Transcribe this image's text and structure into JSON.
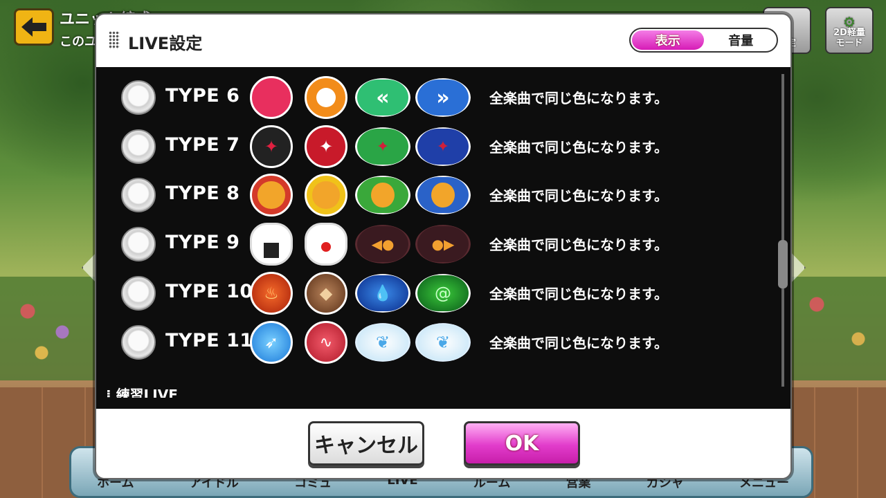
{
  "screen": {
    "title": "ユニット編成",
    "subtitle": "このユ",
    "top_right": [
      {
        "label": "設定",
        "icon": "settings-icon"
      },
      {
        "label_line1": "2D軽量",
        "label_line2": "モード",
        "icon": "gear-icon"
      }
    ],
    "bottom_nav": [
      "ホーム",
      "アイドル",
      "コミュ",
      "LIVE",
      "ルーム",
      "営業",
      "ガシャ",
      "メニュー"
    ]
  },
  "dialog": {
    "title": "LIVE設定",
    "tabs": [
      {
        "label": "表示",
        "active": true
      },
      {
        "label": "音量",
        "active": false
      }
    ],
    "rows": [
      {
        "type": "TYPE 6",
        "desc": "全楽曲で同じ色になります。",
        "icons": [
          "pink-dot-note-icon",
          "orange-ring-note-icon",
          "green-double-chevron-icon",
          "blue-double-chevron-icon"
        ]
      },
      {
        "type": "TYPE 7",
        "desc": "全楽曲で同じ色になります。",
        "icons": [
          "black-geass-icon",
          "red-geass-icon",
          "green-geass-icon",
          "blue-geass-icon"
        ]
      },
      {
        "type": "TYPE 8",
        "desc": "全楽曲で同じ色になります。",
        "icons": [
          "red-dino-icon",
          "yellow-dino-icon",
          "green-dino-icon",
          "blue-dino-icon"
        ]
      },
      {
        "type": "TYPE 9",
        "desc": "全楽曲で同じ色になります。",
        "icons": [
          "onigiri-icon",
          "onigiri-umeboshi-icon",
          "fried-shrimp-left-icon",
          "fried-shrimp-right-icon"
        ]
      },
      {
        "type": "TYPE 10",
        "desc": "全楽曲で同じ色になります。",
        "icons": [
          "fire-icon",
          "earth-icon",
          "water-icon",
          "wind-icon"
        ]
      },
      {
        "type": "TYPE 11",
        "desc": "全楽曲で同じ色になります。",
        "icons": [
          "feather-icon",
          "heartbeat-icon",
          "butterfly-left-icon",
          "butterfly-right-icon"
        ]
      }
    ],
    "next_section": "練習LIVE",
    "cancel_label": "キャンセル",
    "ok_label": "OK"
  },
  "colors": {
    "accent_pink": "#d61bb6",
    "dialog_body": "#0d0d0d"
  }
}
